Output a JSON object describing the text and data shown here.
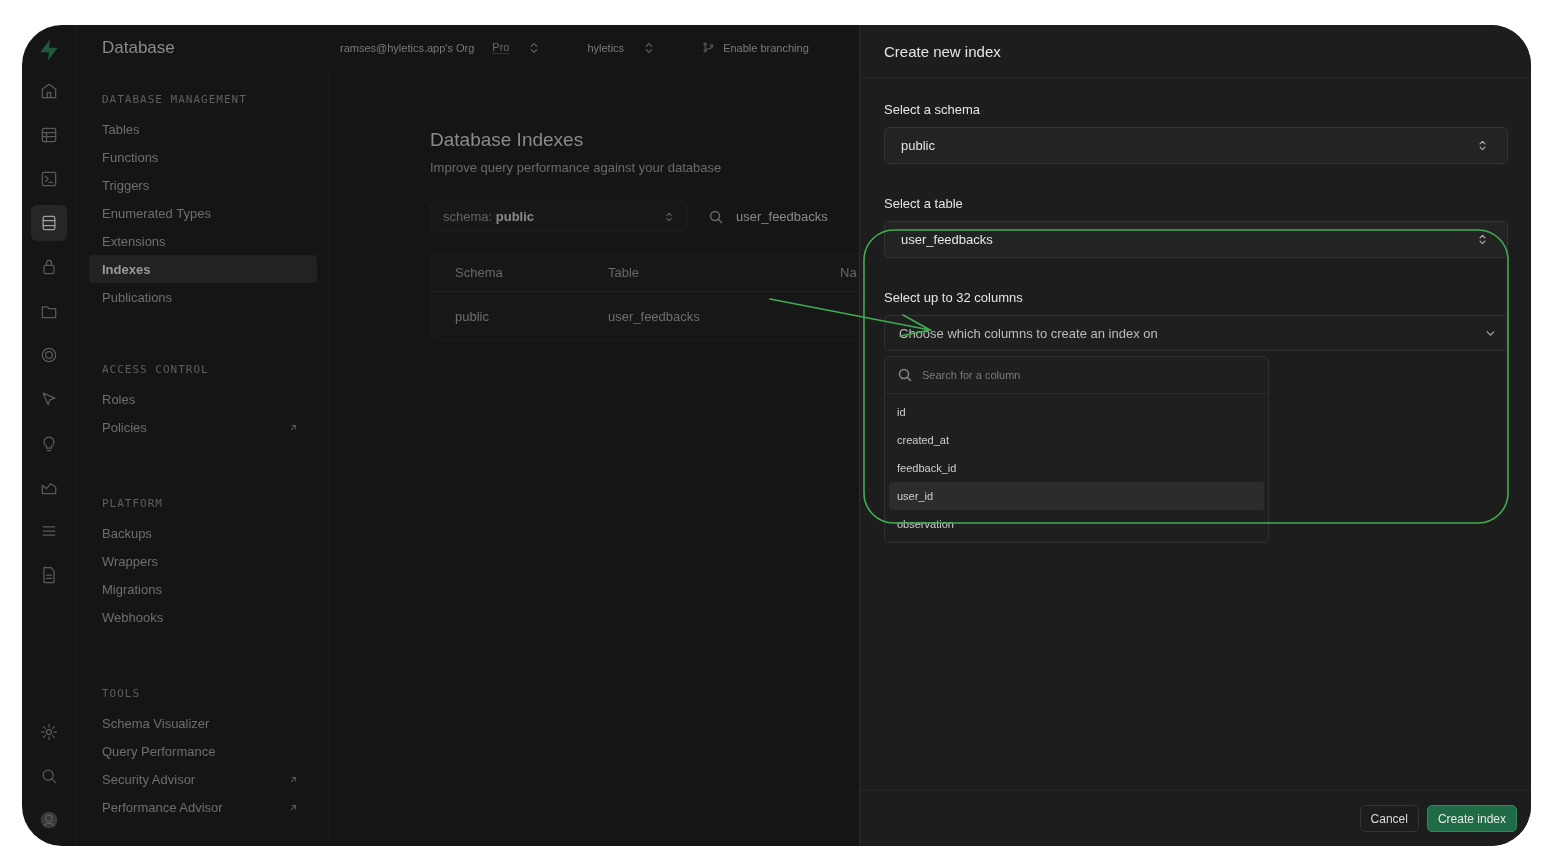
{
  "app": {
    "title": "Database"
  },
  "topbar": {
    "org": "ramses@hyletics.app's Org",
    "plan": "Pro",
    "project": "hyletics",
    "branching": "Enable branching"
  },
  "rail": {
    "top": [
      {
        "kind": "home",
        "selected": false
      },
      {
        "kind": "table",
        "selected": false
      },
      {
        "kind": "terminal",
        "selected": false
      },
      {
        "kind": "database",
        "selected": true
      },
      {
        "kind": "lock",
        "selected": false
      },
      {
        "kind": "folder",
        "selected": false
      },
      {
        "kind": "realtime",
        "selected": false
      },
      {
        "kind": "function",
        "selected": false
      },
      {
        "kind": "bulb",
        "selected": false
      },
      {
        "kind": "chart",
        "selected": false
      },
      {
        "kind": "list",
        "selected": false
      },
      {
        "kind": "document",
        "selected": false
      }
    ],
    "bottom": [
      {
        "kind": "gear",
        "selected": false
      },
      {
        "kind": "search",
        "selected": false
      },
      {
        "kind": "avatar",
        "selected": false
      }
    ]
  },
  "sidebar": {
    "sections": [
      {
        "title": "DATABASE MANAGEMENT",
        "items": [
          {
            "label": "Tables",
            "selected": false,
            "external": false
          },
          {
            "label": "Functions",
            "selected": false,
            "external": false
          },
          {
            "label": "Triggers",
            "selected": false,
            "external": false
          },
          {
            "label": "Enumerated Types",
            "selected": false,
            "external": false
          },
          {
            "label": "Extensions",
            "selected": false,
            "external": false
          },
          {
            "label": "Indexes",
            "selected": true,
            "external": false
          },
          {
            "label": "Publications",
            "selected": false,
            "external": false
          }
        ]
      },
      {
        "title": "ACCESS CONTROL",
        "items": [
          {
            "label": "Roles",
            "selected": false,
            "external": false
          },
          {
            "label": "Policies",
            "selected": false,
            "external": true
          }
        ]
      },
      {
        "title": "PLATFORM",
        "items": [
          {
            "label": "Backups",
            "selected": false,
            "external": false
          },
          {
            "label": "Wrappers",
            "selected": false,
            "external": false
          },
          {
            "label": "Migrations",
            "selected": false,
            "external": false
          },
          {
            "label": "Webhooks",
            "selected": false,
            "external": false
          }
        ]
      },
      {
        "title": "TOOLS",
        "items": [
          {
            "label": "Schema Visualizer",
            "selected": false,
            "external": false
          },
          {
            "label": "Query Performance",
            "selected": false,
            "external": false
          },
          {
            "label": "Security Advisor",
            "selected": false,
            "external": true
          },
          {
            "label": "Performance Advisor",
            "selected": false,
            "external": true
          }
        ]
      }
    ]
  },
  "main": {
    "title": "Database Indexes",
    "subtitle": "Improve query performance against your database",
    "schema_filter": {
      "label": "schema:",
      "value": "public"
    },
    "search": {
      "value": "user_feedbacks"
    },
    "table": {
      "columns": [
        "Schema",
        "Table",
        "Na"
      ],
      "rows": [
        [
          "public",
          "user_feedbacks"
        ]
      ]
    }
  },
  "panel": {
    "title": "Create new index",
    "schema_field": {
      "label": "Select a schema",
      "value": "public"
    },
    "table_field": {
      "label": "Select a table",
      "value": "user_feedbacks"
    },
    "columns_field": {
      "label": "Select up to 32 columns",
      "placeholder": "Choose which columns to create an index on"
    },
    "column_search": {
      "placeholder": "Search for a column"
    },
    "column_options": [
      {
        "label": "id",
        "highlighted": false
      },
      {
        "label": "created_at",
        "highlighted": false
      },
      {
        "label": "feedback_id",
        "highlighted": false
      },
      {
        "label": "user_id",
        "highlighted": true
      },
      {
        "label": "observation",
        "highlighted": false
      }
    ],
    "buttons": [
      {
        "label": "Cancel",
        "kind": "secondary"
      },
      {
        "label": "Create index",
        "kind": "primary"
      }
    ]
  },
  "annotation": {
    "outline": true,
    "arrow": true
  }
}
